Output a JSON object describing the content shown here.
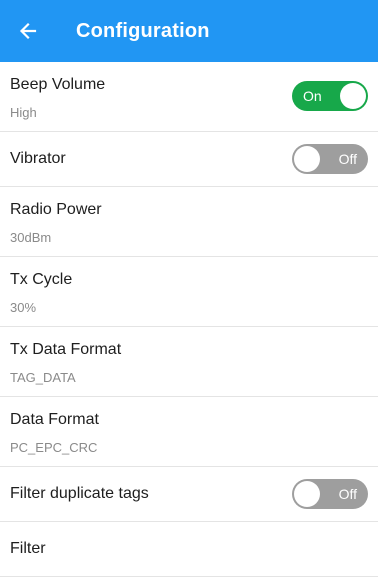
{
  "header": {
    "title": "Configuration",
    "back_icon": "arrow-left-icon"
  },
  "colors": {
    "appbar": "#2196f3",
    "switch_on": "#17a84a",
    "switch_off": "#9e9e9e"
  },
  "settings": {
    "beep_volume": {
      "label": "Beep Volume",
      "value": "High",
      "toggle": "On"
    },
    "vibrator": {
      "label": "Vibrator",
      "toggle": "Off"
    },
    "radio_power": {
      "label": "Radio Power",
      "value": "30dBm"
    },
    "tx_cycle": {
      "label": "Tx Cycle",
      "value": "30%"
    },
    "tx_data_format": {
      "label": "Tx Data Format",
      "value": "TAG_DATA"
    },
    "data_format": {
      "label": "Data Format",
      "value": "PC_EPC_CRC"
    },
    "filter_duplicate_tags": {
      "label": "Filter duplicate tags",
      "toggle": "Off"
    },
    "filter": {
      "label": "Filter"
    }
  }
}
